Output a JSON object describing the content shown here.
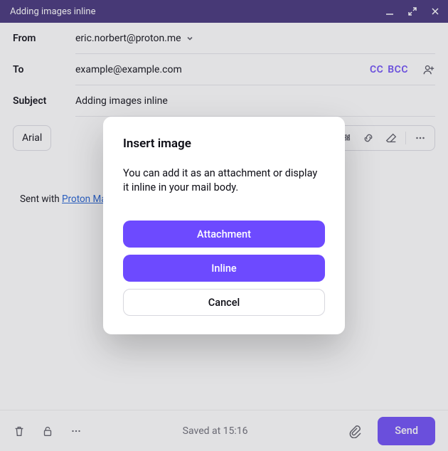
{
  "window": {
    "title": "Adding images inline"
  },
  "compose": {
    "from_label": "From",
    "from_value": "eric.norbert@proton.me",
    "to_label": "To",
    "to_value": "example@example.com",
    "cc_label": "CC",
    "bcc_label": "BCC",
    "subject_label": "Subject",
    "subject_value": "Adding images inline",
    "font_name": "Arial",
    "signature_prefix": "Sent with ",
    "signature_link_text": "Proton Mail"
  },
  "toolbar_icons": {
    "quote": "quote-icon",
    "link": "link-icon",
    "erase": "erase-icon",
    "more": "more-icon"
  },
  "footer": {
    "status_text": "Saved at 15:16",
    "send_label": "Send"
  },
  "modal": {
    "title": "Insert image",
    "body": "You can add it as an attachment or display it inline in your mail body.",
    "attachment_label": "Attachment",
    "inline_label": "Inline",
    "cancel_label": "Cancel"
  },
  "colors": {
    "accent": "#6d4aff",
    "titlebar": "#41307c"
  }
}
